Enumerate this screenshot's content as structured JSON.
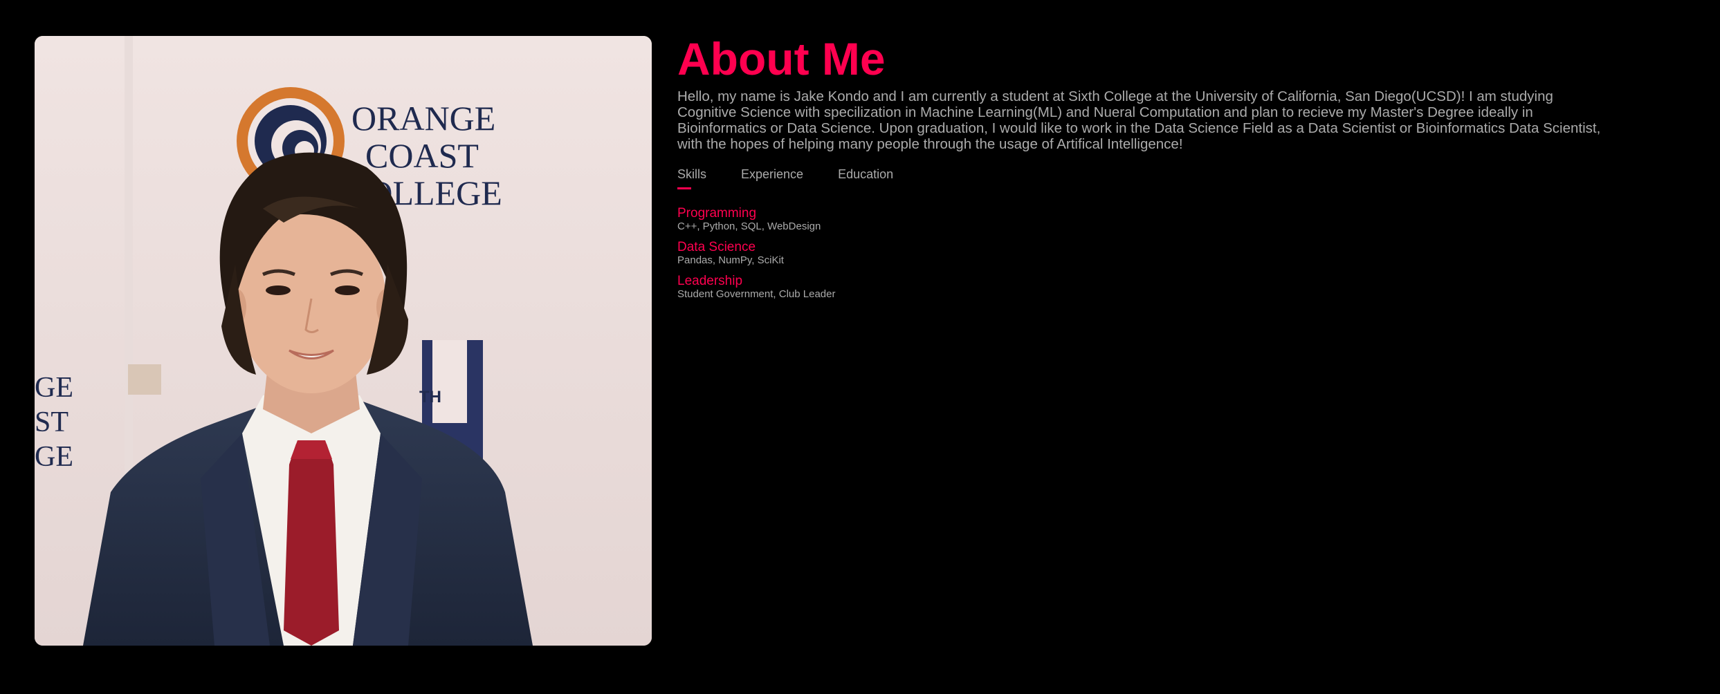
{
  "profile_photo": {
    "alt": "Jake Kondo",
    "backdrop_text": [
      "ORANGE",
      "COAST",
      "COLLEGE"
    ],
    "side_text": [
      "GE",
      "ST",
      "GE"
    ],
    "anniversary_text": "TH"
  },
  "about": {
    "title": "About Me",
    "intro": "Hello, my name is Jake Kondo and I am currently a student at Sixth College at the University of California, San Diego(UCSD)! I am studying Cognitive Science with specilization in Machine Learning(ML) and Nueral Computation and plan to recieve my Master's Degree ideally in Bioinformatics or Data Science. Upon graduation, I would like to work in the Data Science Field as a Data Scientist or Bioinformatics Data Scientist, with the hopes of helping many people through the usage of Artifical Intelligence!"
  },
  "tabs": [
    {
      "label": "Skills",
      "active": true
    },
    {
      "label": "Experience",
      "active": false
    },
    {
      "label": "Education",
      "active": false
    }
  ],
  "skills": [
    {
      "name": "Programming",
      "detail": "C++, Python, SQL, WebDesign"
    },
    {
      "name": "Data Science",
      "detail": "Pandas, NumPy, SciKit"
    },
    {
      "name": "Leadership",
      "detail": "Student Government, Club Leader"
    }
  ],
  "colors": {
    "accent": "#ff004f",
    "background": "#000000",
    "text": "#ababab"
  }
}
